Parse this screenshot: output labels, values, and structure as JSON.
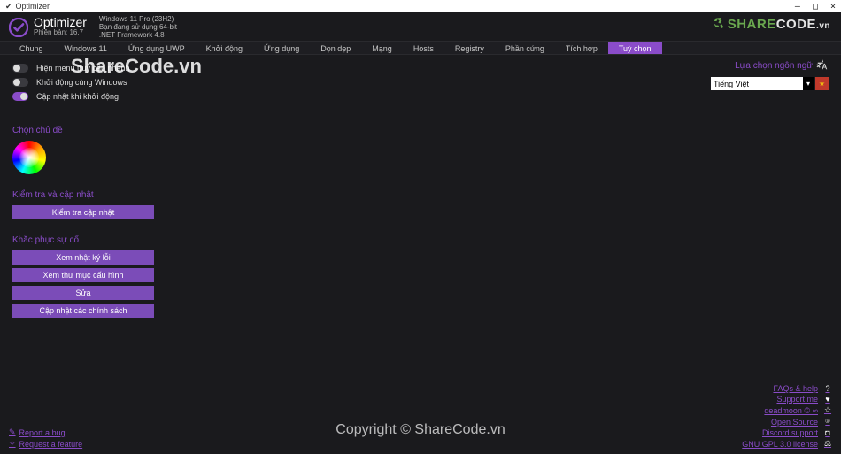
{
  "os": {
    "title": "Optimizer",
    "min": "—",
    "max": "□",
    "close": "×"
  },
  "header": {
    "app_name": "Optimizer",
    "version_line": "Phiên bản: 16.7",
    "sys1": "Windows 11 Pro (23H2)",
    "sys2": "Bạn đang sử dụng 64-bit",
    "sys3": ".NET Framework 4.8",
    "brand_left": "SHARE",
    "brand_right": "CODE",
    "brand_tld": ".vn"
  },
  "tabs": [
    "Chung",
    "Windows 11",
    "Ứng dụng UWP",
    "Khởi động",
    "Ứng dụng",
    "Dọn dẹp",
    "Mạng",
    "Hosts",
    "Registry",
    "Phần cứng",
    "Tích hợp",
    "Tuỳ chọn"
  ],
  "tabs_active_index": 11,
  "toggles": [
    {
      "label": "Hiện menu truy cập nhanh",
      "on": false
    },
    {
      "label": "Khởi động cùng Windows",
      "on": false
    },
    {
      "label": "Cập nhật khi khởi động",
      "on": true
    }
  ],
  "language": {
    "title": "Lựa chọn ngôn ngữ",
    "selected": "Tiếng Việt"
  },
  "theme_h": "Chọn chủ đề",
  "update_h": "Kiểm tra và cập nhật",
  "update_btn": "Kiểm tra cập nhật",
  "trouble_h": "Khắc phục sự cố",
  "trouble_btns": [
    "Xem nhật ký lỗi",
    "Xem thư mục cấu hình",
    "Sửa",
    "Cập nhật các chính sách"
  ],
  "bl": {
    "bug": "Report a bug",
    "feature": "Request a feature"
  },
  "br": [
    {
      "label": "FAQs & help",
      "glyph": "?"
    },
    {
      "label": "Support me",
      "glyph": "♥"
    },
    {
      "label": "deadmoon © ∞",
      "glyph": "☆"
    },
    {
      "label": "Open Source",
      "glyph": "⌾"
    },
    {
      "label": "Discord support",
      "glyph": "◘"
    },
    {
      "label": "GNU GPL 3.0 license",
      "glyph": "⚖"
    }
  ],
  "wm1": "ShareCode.vn",
  "wm2": "Copyright © ShareCode.vn"
}
